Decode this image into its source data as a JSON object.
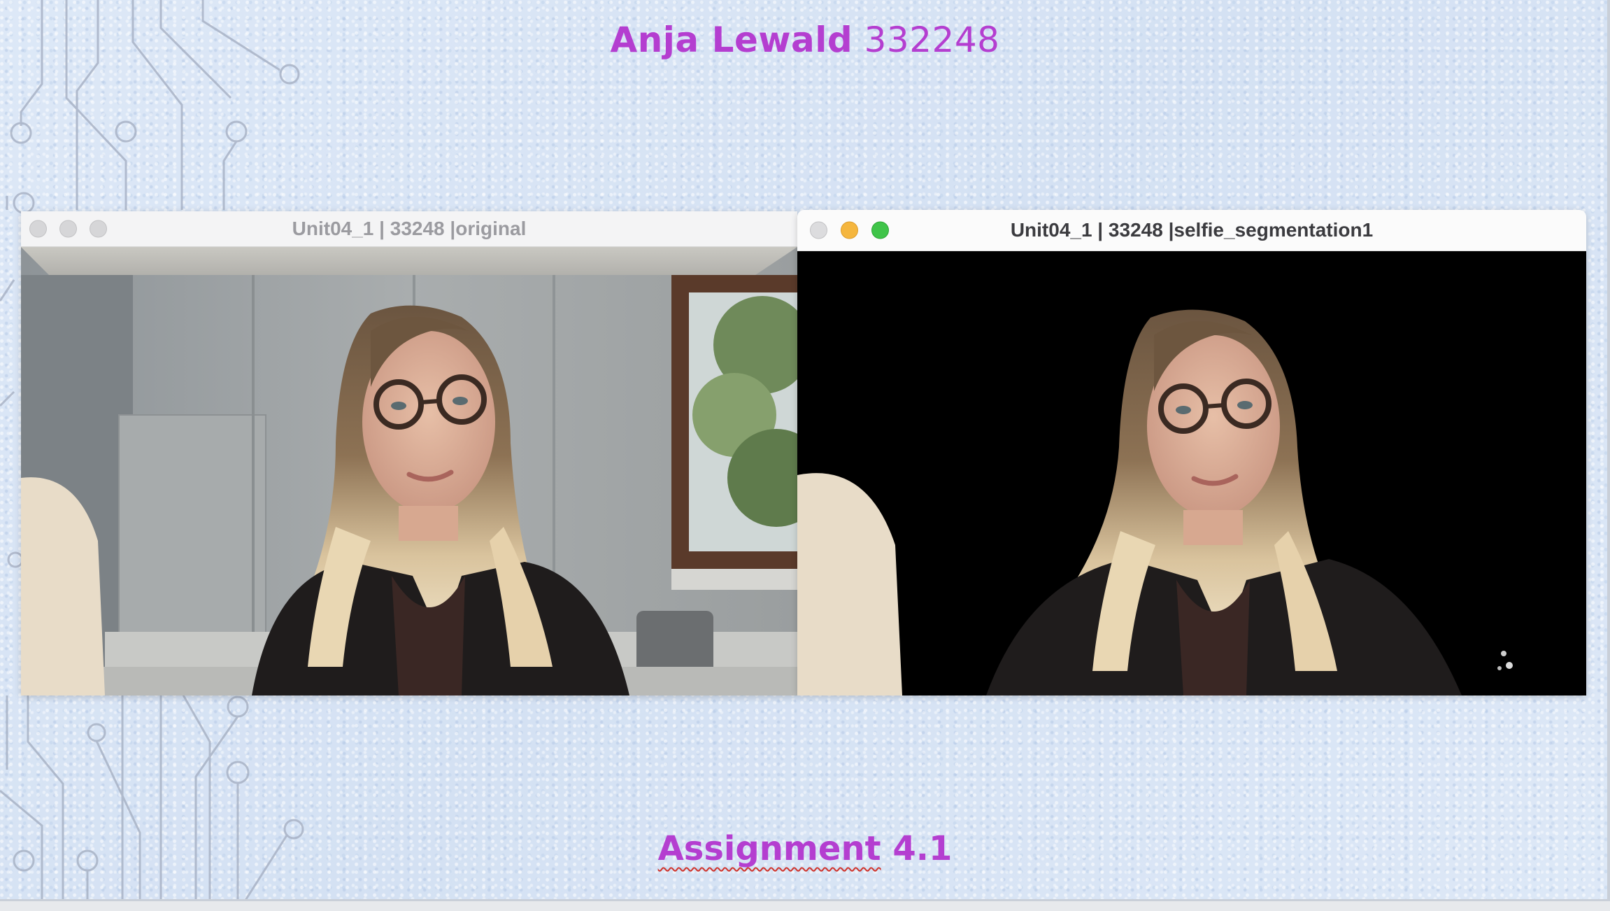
{
  "slide": {
    "title_name": "Anja Lewald",
    "title_id": "332248",
    "footer_word": "Assignment",
    "footer_number": "4.1"
  },
  "windows": [
    {
      "title": "Unit04_1 | 33248 |original",
      "state": "inactive"
    },
    {
      "title": "Unit04_1 | 33248 |selfie_segmentation1",
      "state": "active"
    }
  ],
  "colors": {
    "title_text": "#b43ed0",
    "slide_background": "#d9e5f5",
    "spellcheck_underline": "#d0342c",
    "traffic_close": "#dcdcde",
    "traffic_minimize": "#f5b63e",
    "traffic_zoom": "#3fc449"
  }
}
